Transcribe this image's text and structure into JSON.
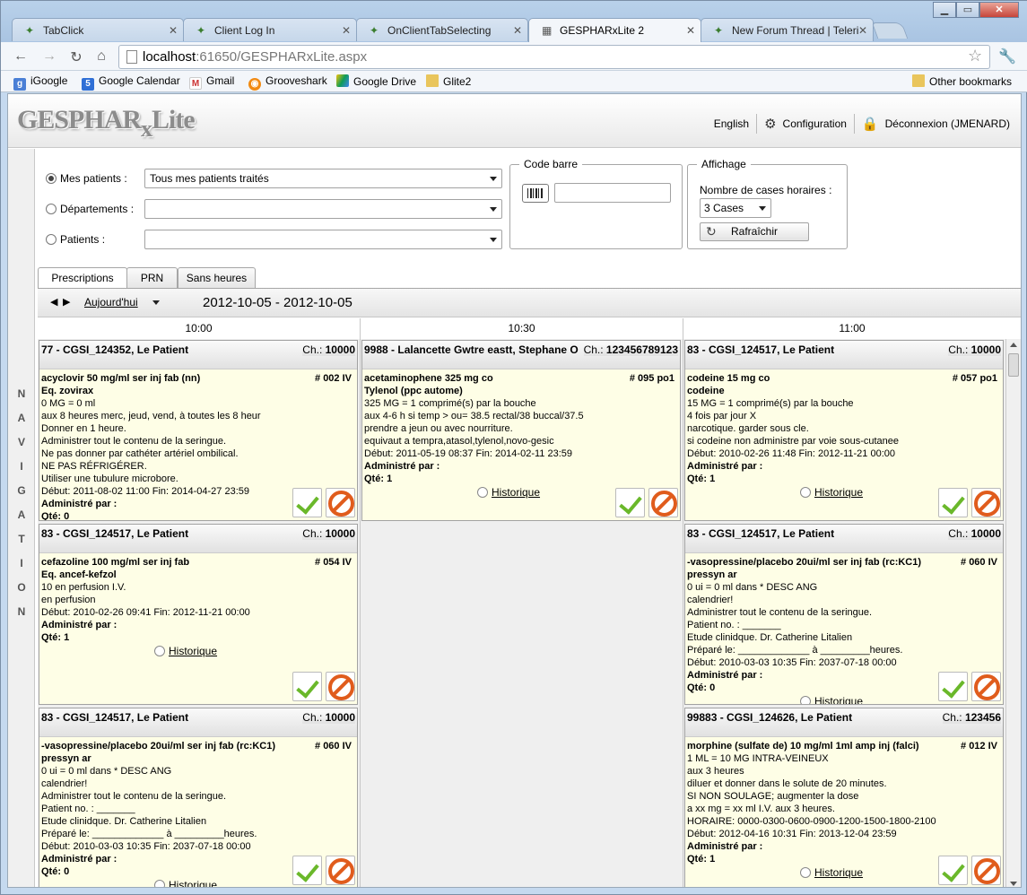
{
  "browser": {
    "tabs": [
      {
        "title": "TabClick"
      },
      {
        "title": "Client Log In"
      },
      {
        "title": "OnClientTabSelecting"
      },
      {
        "title": "GESPHARxLite 2"
      },
      {
        "title": "New Forum Thread | Teleri"
      }
    ],
    "url_host": "localhost",
    "url_path": ":61650/GESPHARxLite.aspx",
    "bookmarks": [
      "iGoogle",
      "Google Calendar",
      "Gmail",
      "Grooveshark",
      "Google Drive",
      "Glite2"
    ],
    "other_bookmarks": "Other bookmarks"
  },
  "app": {
    "logo_main": "GESPHAR",
    "logo_x": "x",
    "logo_lite": "Lite",
    "lang": "English",
    "config": "Configuration",
    "logout": "Déconnexion (JMENARD)",
    "nav_letters": [
      "N",
      "A",
      "V",
      "I",
      "G",
      "A",
      "T",
      "I",
      "O",
      "N"
    ]
  },
  "filters": {
    "mes_patients_label": "Mes patients :",
    "mes_patients_value": "Tous mes patients traités",
    "departements_label": "Départements :",
    "patients_label": "Patients :",
    "code_barre_legend": "Code barre",
    "affichage_legend": "Affichage",
    "nb_cases_label": "Nombre de cases horaires :",
    "nb_cases_value": "3 Cases",
    "refresh": "Rafraîchir"
  },
  "tabs": [
    "Prescriptions",
    "PRN",
    "Sans heures"
  ],
  "datebar": {
    "today": "Aujourd'hui",
    "range": "2012-10-05 - 2012-10-05"
  },
  "columns": [
    "10:00",
    "10:30",
    "11:00"
  ],
  "labels": {
    "administre": "Administré par :",
    "qte": "Qté:",
    "historique": "Historique",
    "ch": "Ch.:"
  },
  "cards": [
    {
      "title": "77 - CGSI_124352, Le Patient",
      "room": "10000",
      "num": "# 002 IV",
      "drug": "acyclovir 50 mg/ml ser inj fab (nn)",
      "eq": "Eq. zovirax",
      "lines": [
        "0 MG = 0 ml",
        "aux 8 heures merc, jeud, vend, à toutes les 8 heur",
        "Donner en 1 heure.",
        "Administrer tout le contenu de la seringue.",
        "Ne pas donner par cathéter artériel ombilical.",
        "NE PAS RÉFRIGÉRER.",
        "Utiliser une tubulure microbore.",
        "Début: 2011-08-02 11:00 Fin: 2014-04-27 23:59"
      ],
      "qty": "0"
    },
    {
      "title": "9988 - Lalancette Gwtre eastt, Stephane O",
      "room": "123456789123",
      "num": "# 095 po1",
      "drug": "acetaminophene 325 mg co",
      "eq": "Tylenol (ppc autome)",
      "lines": [
        "325 MG = 1 comprimé(s) par la bouche",
        "aux 4-6 h si temp > ou= 38.5 rectal/38 buccal/37.5",
        "prendre a jeun ou avec nourriture.",
        "equivaut a tempra,atasol,tylenol,novo-gesic",
        "Début: 2011-05-19 08:37 Fin: 2014-02-11 23:59"
      ],
      "qty": "1"
    },
    {
      "title": "83 - CGSI_124517, Le Patient",
      "room": "10000",
      "num": "# 057 po1",
      "drug": "codeine 15 mg co",
      "eq": "codeine",
      "lines": [
        "15 MG = 1 comprimé(s) par la bouche",
        "4 fois par jour X",
        "narcotique. garder sous cle.",
        "si codeine non administre par voie sous-cutanee",
        "Début: 2010-02-26 11:48 Fin: 2012-11-21 00:00"
      ],
      "qty": "1"
    },
    {
      "title": "83 - CGSI_124517, Le Patient",
      "room": "10000",
      "num": "# 054 IV",
      "drug": "cefazoline 100 mg/ml ser inj fab",
      "eq": "Eq. ancef-kefzol",
      "lines": [
        "10 en perfusion I.V.",
        "en perfusion",
        "Début: 2010-02-26 09:41 Fin: 2012-11-21 00:00"
      ],
      "qty": "1"
    },
    {
      "title": "83 - CGSI_124517, Le Patient",
      "room": "10000",
      "num": "# 060 IV",
      "drug": "-vasopressine/placebo 20ui/ml ser inj fab (rc:KC1)",
      "eq": "pressyn ar",
      "lines": [
        "0 ui = 0 ml dans * DESC ANG",
        "calendrier!",
        "Administrer tout le contenu de la seringue.",
        "Patient no. : _______",
        "Etude clinidque. Dr. Catherine Litalien",
        "Préparé le: _____________ à _________heures.",
        "Début: 2010-03-03 10:35 Fin: 2037-07-18 00:00"
      ],
      "qty": "0"
    },
    {
      "title": "83 - CGSI_124517, Le Patient",
      "room": "10000",
      "num": "# 060 IV",
      "drug": "-vasopressine/placebo 20ui/ml ser inj fab (rc:KC1)",
      "eq": "pressyn ar",
      "lines": [
        "0 ui = 0 ml dans * DESC ANG",
        "calendrier!",
        "Administrer tout le contenu de la seringue.",
        "Patient no. : _______",
        "Etude clinidque. Dr. Catherine Litalien",
        "Préparé le: _____________ à _________heures.",
        "Début: 2010-03-03 10:35 Fin: 2037-07-18 00:00"
      ],
      "qty": "0"
    },
    {
      "title": "99883 - CGSI_124626, Le Patient",
      "room": "123456",
      "num": "# 012 IV",
      "drug": "morphine (sulfate de) 10 mg/ml 1ml amp inj (falci)",
      "eq": "",
      "lines": [
        "1 ML = 10 MG INTRA-VEINEUX",
        "aux 3 heures",
        "diluer et donner dans le solute de 20 minutes.",
        "SI NON SOULAGE; augmenter la dose",
        "a xx mg = xx ml I.V. aux 3 heures.",
        "HORAIRE: 0000-0300-0600-0900-1200-1500-1800-2100",
        "Début: 2012-04-16 10:31 Fin: 2013-12-04 23:59"
      ],
      "qty": "1"
    }
  ]
}
